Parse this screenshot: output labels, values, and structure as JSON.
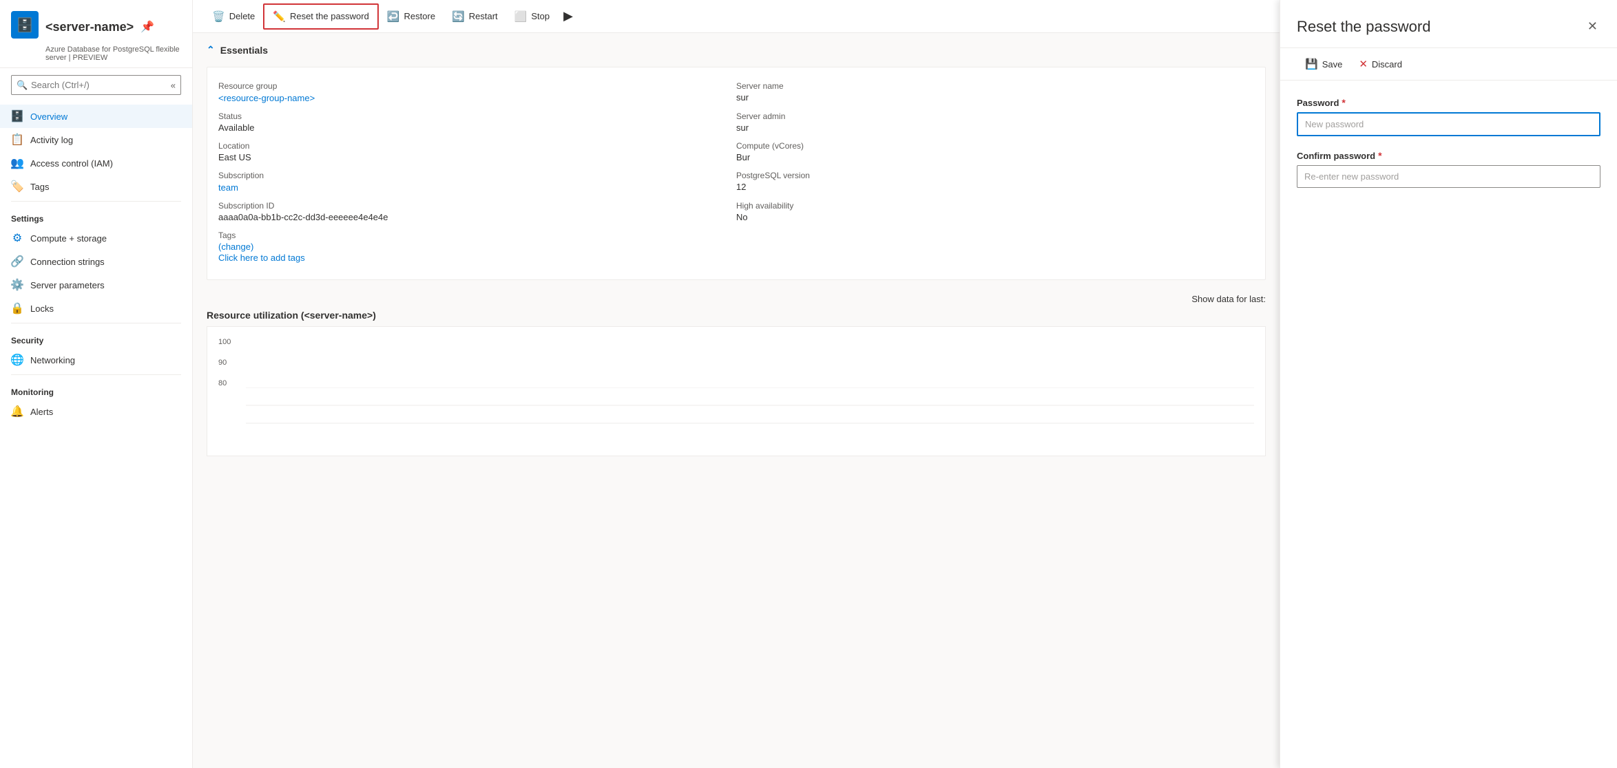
{
  "sidebar": {
    "server_name": "<server-name>",
    "subtitle": "Azure Database for PostgreSQL flexible server | PREVIEW",
    "search_placeholder": "Search (Ctrl+/)",
    "collapse_icon": "«",
    "nav_items": [
      {
        "id": "overview",
        "label": "Overview",
        "icon": "🗄️",
        "active": true
      },
      {
        "id": "activity-log",
        "label": "Activity log",
        "icon": "📋",
        "active": false
      },
      {
        "id": "access-control",
        "label": "Access control (IAM)",
        "icon": "👥",
        "active": false
      },
      {
        "id": "tags",
        "label": "Tags",
        "icon": "🏷️",
        "active": false
      }
    ],
    "settings_label": "Settings",
    "settings_items": [
      {
        "id": "compute-storage",
        "label": "Compute + storage",
        "icon": "⚙️"
      },
      {
        "id": "connection-strings",
        "label": "Connection strings",
        "icon": "🔗"
      },
      {
        "id": "server-parameters",
        "label": "Server parameters",
        "icon": "⚙️"
      },
      {
        "id": "locks",
        "label": "Locks",
        "icon": "🔒"
      }
    ],
    "security_label": "Security",
    "security_items": [
      {
        "id": "networking",
        "label": "Networking",
        "icon": "🌐"
      }
    ],
    "monitoring_label": "Monitoring",
    "monitoring_items": [
      {
        "id": "alerts",
        "label": "Alerts",
        "icon": "🔔"
      }
    ]
  },
  "toolbar": {
    "delete_label": "Delete",
    "reset_password_label": "Reset the password",
    "restore_label": "Restore",
    "restart_label": "Restart",
    "stop_label": "Stop"
  },
  "essentials": {
    "header": "Essentials",
    "items": [
      {
        "label": "Resource group",
        "value": "<resource-group-name>",
        "is_link": true
      },
      {
        "label": "Server name",
        "value": "sur",
        "truncated": true
      },
      {
        "label": "Status",
        "value": "Available"
      },
      {
        "label": "Server admin",
        "value": "sur",
        "truncated": true
      },
      {
        "label": "Location",
        "value": "East US"
      },
      {
        "label": "Compute (vCores)",
        "value": "Bur",
        "truncated": true
      },
      {
        "label": "Subscription",
        "value": "team",
        "is_link": true
      },
      {
        "label": "PostgreSQL version",
        "value": "12"
      },
      {
        "label": "Subscription ID",
        "value": "aaaa0a0a-bb1b-cc2c-dd3d-eeeeee4e4e4e"
      },
      {
        "label": "High availability",
        "value": "No"
      }
    ],
    "tags_label": "Tags",
    "change_link": "(change)",
    "add_tags_link": "Click here to add tags"
  },
  "show_data": {
    "label": "Show data for last:"
  },
  "resource_utilization": {
    "title": "Resource utilization (<server-name>)",
    "y_labels": [
      "100",
      "90",
      "80"
    ]
  },
  "panel": {
    "title": "Reset the password",
    "close_icon": "✕",
    "save_label": "Save",
    "discard_label": "Discard",
    "password_label": "Password",
    "password_placeholder": "New password",
    "confirm_label": "Confirm password",
    "confirm_placeholder": "Re-enter new password"
  }
}
